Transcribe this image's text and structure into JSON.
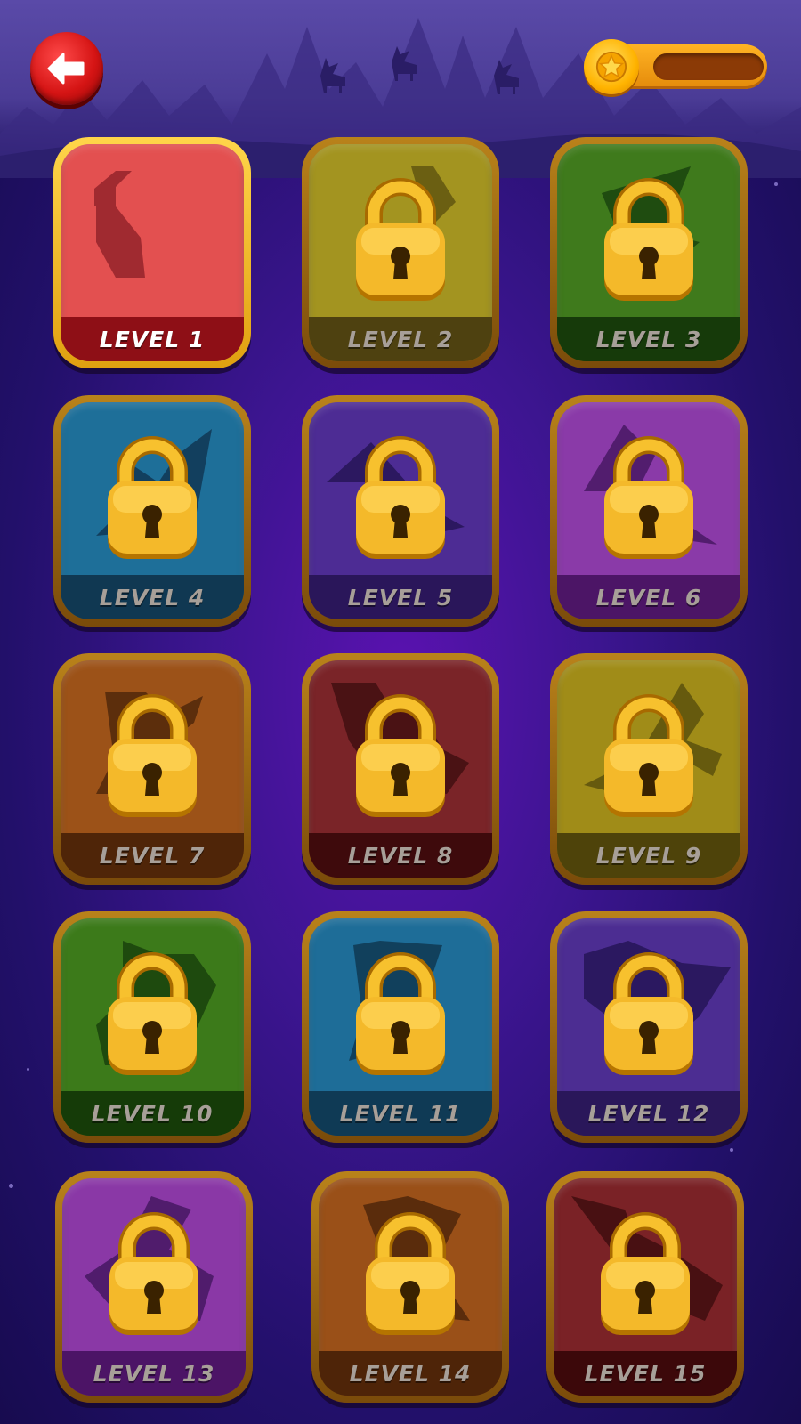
{
  "header": {
    "back_icon": "arrow-left-icon",
    "score_icon": "star-icon",
    "score_value": ""
  },
  "colors": {
    "lock_gold": "#f2b62a",
    "unlocked_border": "#ffc430",
    "locked_border": "#9a6612"
  },
  "levels": [
    {
      "label": "LEVEL 1",
      "locked": false,
      "bg": "#e35050",
      "band": "#8e0f16",
      "shape": "#a02a30"
    },
    {
      "label": "LEVEL 2",
      "locked": true,
      "bg": "#a39420",
      "band": "#4e4110",
      "shape": "#6b5f12"
    },
    {
      "label": "LEVEL 3",
      "locked": true,
      "bg": "#3f7a1c",
      "band": "#163a0a",
      "shape": "#1f4c10"
    },
    {
      "label": "LEVEL 4",
      "locked": true,
      "bg": "#1e6f99",
      "band": "#103852",
      "shape": "#123f5e"
    },
    {
      "label": "LEVEL 5",
      "locked": true,
      "bg": "#4d2c94",
      "band": "#2a165a",
      "shape": "#2c1860"
    },
    {
      "label": "LEVEL 6",
      "locked": true,
      "bg": "#8a3aa8",
      "band": "#4c1566",
      "shape": "#521d6e"
    },
    {
      "label": "LEVEL 7",
      "locked": true,
      "bg": "#9c5218",
      "band": "#4f2508",
      "shape": "#5c2e0c"
    },
    {
      "label": "LEVEL 8",
      "locked": true,
      "bg": "#7a2428",
      "band": "#3e0a0c",
      "shape": "#4a1214"
    },
    {
      "label": "LEVEL 9",
      "locked": true,
      "bg": "#a08c18",
      "band": "#4e430a",
      "shape": "#665a0e"
    },
    {
      "label": "LEVEL 10",
      "locked": true,
      "bg": "#3c7a1a",
      "band": "#153b08",
      "shape": "#1e4a0e"
    },
    {
      "label": "LEVEL 11",
      "locked": true,
      "bg": "#1e6d98",
      "band": "#0f3a55",
      "shape": "#11405c"
    },
    {
      "label": "LEVEL 12",
      "locked": true,
      "bg": "#4c2d92",
      "band": "#2a175a",
      "shape": "#2b1860"
    },
    {
      "label": "LEVEL 13",
      "locked": true,
      "bg": "#8a38a6",
      "band": "#4c1466",
      "shape": "#501c6c"
    },
    {
      "label": "LEVEL 14",
      "locked": true,
      "bg": "#9a5018",
      "band": "#4e2408",
      "shape": "#5a2c0c"
    },
    {
      "label": "LEVEL 15",
      "locked": true,
      "bg": "#7a2226",
      "band": "#3c080a",
      "shape": "#481012"
    }
  ]
}
